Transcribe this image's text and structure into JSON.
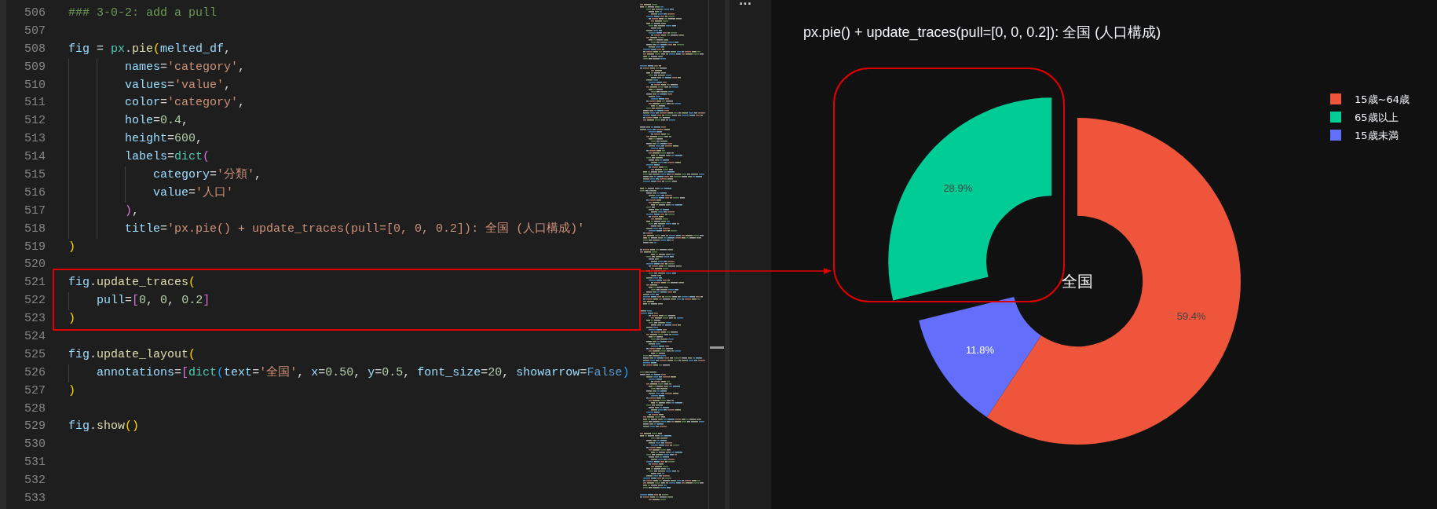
{
  "editor": {
    "lines": [
      {
        "number": "506",
        "tokens": [
          {
            "kind": "comment",
            "text": "### 3-0-2: add a pull"
          }
        ]
      },
      {
        "number": "507"
      },
      {
        "number": "508",
        "tokens": [
          {
            "kind": "var",
            "text": "fig"
          },
          {
            "kind": "punct",
            "text": " = "
          },
          {
            "kind": "cls",
            "text": "px"
          },
          {
            "kind": "punct",
            "text": "."
          },
          {
            "kind": "fn",
            "text": "pie"
          },
          {
            "kind": "b1",
            "text": "("
          },
          {
            "kind": "var",
            "text": "melted_df"
          },
          {
            "kind": "punct",
            "text": ","
          }
        ]
      },
      {
        "number": "509",
        "tokens": [
          {
            "kind": "var",
            "text": "        names"
          },
          {
            "kind": "punct",
            "text": "="
          },
          {
            "kind": "str",
            "text": "'category'"
          },
          {
            "kind": "punct",
            "text": ","
          }
        ]
      },
      {
        "number": "510",
        "tokens": [
          {
            "kind": "var",
            "text": "        values"
          },
          {
            "kind": "punct",
            "text": "="
          },
          {
            "kind": "str",
            "text": "'value'"
          },
          {
            "kind": "punct",
            "text": ","
          }
        ]
      },
      {
        "number": "511",
        "tokens": [
          {
            "kind": "var",
            "text": "        color"
          },
          {
            "kind": "punct",
            "text": "="
          },
          {
            "kind": "str",
            "text": "'category'"
          },
          {
            "kind": "punct",
            "text": ","
          }
        ]
      },
      {
        "number": "512",
        "tokens": [
          {
            "kind": "var",
            "text": "        hole"
          },
          {
            "kind": "punct",
            "text": "="
          },
          {
            "kind": "num",
            "text": "0.4"
          },
          {
            "kind": "punct",
            "text": ","
          }
        ]
      },
      {
        "number": "513",
        "tokens": [
          {
            "kind": "var",
            "text": "        height"
          },
          {
            "kind": "punct",
            "text": "="
          },
          {
            "kind": "num",
            "text": "600"
          },
          {
            "kind": "punct",
            "text": ","
          }
        ]
      },
      {
        "number": "514",
        "tokens": [
          {
            "kind": "var",
            "text": "        labels"
          },
          {
            "kind": "punct",
            "text": "="
          },
          {
            "kind": "cls",
            "text": "dict"
          },
          {
            "kind": "b2",
            "text": "("
          }
        ]
      },
      {
        "number": "515",
        "tokens": [
          {
            "kind": "var",
            "text": "            category"
          },
          {
            "kind": "punct",
            "text": "="
          },
          {
            "kind": "str",
            "text": "'分類'"
          },
          {
            "kind": "punct",
            "text": ","
          }
        ]
      },
      {
        "number": "516",
        "tokens": [
          {
            "kind": "var",
            "text": "            value"
          },
          {
            "kind": "punct",
            "text": "="
          },
          {
            "kind": "str",
            "text": "'人口'"
          }
        ]
      },
      {
        "number": "517",
        "tokens": [
          {
            "kind": "b2",
            "text": "        )"
          },
          {
            "kind": "punct",
            "text": ","
          }
        ]
      },
      {
        "number": "518",
        "tokens": [
          {
            "kind": "var",
            "text": "        title"
          },
          {
            "kind": "punct",
            "text": "="
          },
          {
            "kind": "str",
            "text": "'px.pie() + update_traces(pull=[0, 0, 0.2]): 全国 (人口構成)'"
          }
        ]
      },
      {
        "number": "519",
        "tokens": [
          {
            "kind": "b1",
            "text": ")"
          }
        ]
      },
      {
        "number": "520"
      },
      {
        "number": "521",
        "tokens": [
          {
            "kind": "var",
            "text": "fig"
          },
          {
            "kind": "punct",
            "text": "."
          },
          {
            "kind": "fn",
            "text": "update_traces"
          },
          {
            "kind": "b1",
            "text": "("
          }
        ]
      },
      {
        "number": "522",
        "tokens": [
          {
            "kind": "var",
            "text": "    pull"
          },
          {
            "kind": "punct",
            "text": "="
          },
          {
            "kind": "b2",
            "text": "["
          },
          {
            "kind": "num",
            "text": "0"
          },
          {
            "kind": "punct",
            "text": ", "
          },
          {
            "kind": "num",
            "text": "0"
          },
          {
            "kind": "punct",
            "text": ", "
          },
          {
            "kind": "num",
            "text": "0.2"
          },
          {
            "kind": "b2",
            "text": "]"
          }
        ]
      },
      {
        "number": "523",
        "tokens": [
          {
            "kind": "b1",
            "text": ")"
          }
        ]
      },
      {
        "number": "524"
      },
      {
        "number": "525",
        "tokens": [
          {
            "kind": "var",
            "text": "fig"
          },
          {
            "kind": "punct",
            "text": "."
          },
          {
            "kind": "fn",
            "text": "update_layout"
          },
          {
            "kind": "b1",
            "text": "("
          }
        ]
      },
      {
        "number": "526",
        "tokens": [
          {
            "kind": "var",
            "text": "    annotations"
          },
          {
            "kind": "punct",
            "text": "="
          },
          {
            "kind": "b2",
            "text": "["
          },
          {
            "kind": "cls",
            "text": "dict"
          },
          {
            "kind": "b3",
            "text": "("
          },
          {
            "kind": "var",
            "text": "text"
          },
          {
            "kind": "punct",
            "text": "="
          },
          {
            "kind": "str",
            "text": "'全国'"
          },
          {
            "kind": "punct",
            "text": ", "
          },
          {
            "kind": "var",
            "text": "x"
          },
          {
            "kind": "punct",
            "text": "="
          },
          {
            "kind": "num",
            "text": "0.50"
          },
          {
            "kind": "punct",
            "text": ", "
          },
          {
            "kind": "var",
            "text": "y"
          },
          {
            "kind": "punct",
            "text": "="
          },
          {
            "kind": "num",
            "text": "0.5"
          },
          {
            "kind": "punct",
            "text": ", "
          },
          {
            "kind": "var",
            "text": "font_size"
          },
          {
            "kind": "punct",
            "text": "="
          },
          {
            "kind": "num",
            "text": "20"
          },
          {
            "kind": "punct",
            "text": ", "
          },
          {
            "kind": "var",
            "text": "showarrow"
          },
          {
            "kind": "punct",
            "text": "="
          },
          {
            "kind": "const",
            "text": "False"
          },
          {
            "kind": "b3",
            "text": ")"
          }
        ]
      },
      {
        "number": "527",
        "tokens": [
          {
            "kind": "b1",
            "text": ")"
          }
        ]
      },
      {
        "number": "528"
      },
      {
        "number": "529",
        "tokens": [
          {
            "kind": "var",
            "text": "fig"
          },
          {
            "kind": "punct",
            "text": "."
          },
          {
            "kind": "fn",
            "text": "show"
          },
          {
            "kind": "b1",
            "text": "()"
          }
        ]
      },
      {
        "number": "530"
      },
      {
        "number": "531"
      },
      {
        "number": "532"
      },
      {
        "number": "533"
      }
    ]
  },
  "panel_menu": "...",
  "plot": {
    "chart_data": {
      "type": "donut",
      "title": "px.pie() + update_traces(pull=[0, 0, 0.2]): 全国 (人口構成)",
      "categories": [
        "15歳~64歳",
        "15歳未満",
        "65歳以上"
      ],
      "values": [
        59.4,
        11.8,
        28.9
      ],
      "colors": [
        "#ef553b",
        "#636efa",
        "#00cc96"
      ],
      "value_labels": [
        "59.4%",
        "11.8%",
        "28.9%"
      ],
      "legend": true,
      "annotations": [
        {
          "text": "全国"
        }
      ]
    },
    "pulled": [
      false,
      false,
      true
    ]
  }
}
